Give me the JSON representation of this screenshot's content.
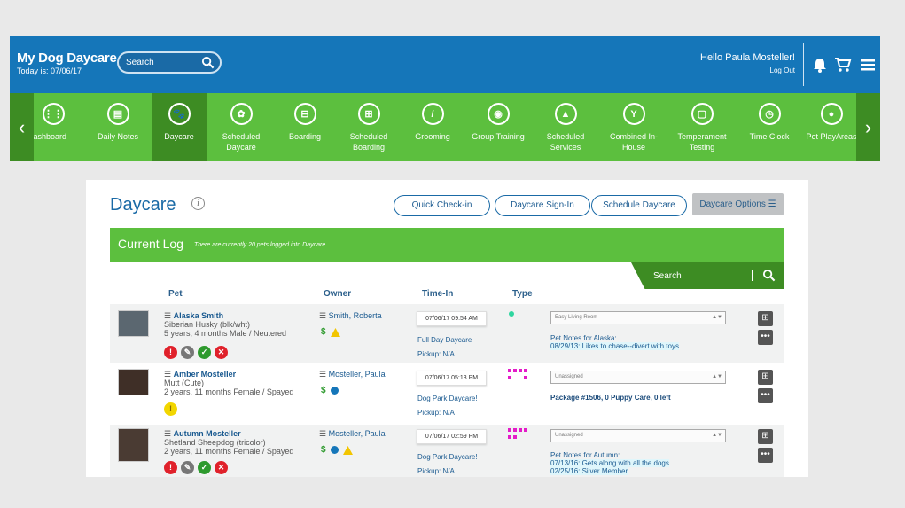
{
  "header": {
    "app_title": "My Dog Daycare",
    "today": "Today is: 07/06/17",
    "search_placeholder": "Search",
    "greeting": "Hello Paula Mosteller!",
    "logout": "Log Out"
  },
  "nav": {
    "prev": "‹",
    "next": "›",
    "items": [
      {
        "label": "Dashboard",
        "label2": "",
        "icon": "⋮⋮"
      },
      {
        "label": "Daily Notes",
        "label2": "",
        "icon": "▤"
      },
      {
        "label": "Daycare",
        "label2": "",
        "icon": "🐾"
      },
      {
        "label": "Scheduled",
        "label2": "Daycare",
        "icon": "✿"
      },
      {
        "label": "Boarding",
        "label2": "",
        "icon": "⊟"
      },
      {
        "label": "Scheduled",
        "label2": "Boarding",
        "icon": "⊞"
      },
      {
        "label": "Grooming",
        "label2": "",
        "icon": "/"
      },
      {
        "label": "Group Training",
        "label2": "",
        "icon": "◉"
      },
      {
        "label": "Scheduled",
        "label2": "Services",
        "icon": "▲"
      },
      {
        "label": "Combined In-",
        "label2": "House",
        "icon": "Y"
      },
      {
        "label": "Temperament",
        "label2": "Testing",
        "icon": "▢"
      },
      {
        "label": "Time Clock",
        "label2": "",
        "icon": "◷"
      },
      {
        "label": "Pet PlayAreas",
        "label2": "",
        "icon": "●"
      }
    ]
  },
  "page": {
    "title": "Daycare",
    "info": "i",
    "btn_quick": "Quick Check-in",
    "btn_signin": "Daycare Sign-In",
    "btn_schedule": "Schedule Daycare",
    "btn_options": "Daycare Options ☰",
    "log_title": "Current Log",
    "log_sub": "There are currently 20 pets logged into Daycare.",
    "table_search": "Search",
    "cols": {
      "pet": "Pet",
      "owner": "Owner",
      "timein": "Time-In",
      "type": "Type"
    }
  },
  "rows": [
    {
      "pet": "Alaska Smith",
      "breed": "Siberian Husky (blk/wht)",
      "age": "5 years, 4 months Male / Neutered",
      "owner": "Smith, Roberta",
      "time": "07/06/17 09:54 AM",
      "svc1": "Full Day Daycare",
      "svc2": "Pickup: N/A",
      "select": "Easy Living Room",
      "note1": "Pet Notes for Alaska:",
      "note2": "08/29/13: Likes to chase--divert with toys",
      "note3": ""
    },
    {
      "pet": "Amber Mosteller",
      "breed": "Mutt (Cute)",
      "age": "2 years, 11 months Female / Spayed",
      "owner": "Mosteller, Paula",
      "time": "07/06/17 05:13 PM",
      "svc1": "Dog Park Daycare!",
      "svc2": "Pickup: N/A",
      "select": "Unassigned",
      "note1": "Package #1506, 0 Puppy Care, 0 left",
      "note2": "",
      "note3": ""
    },
    {
      "pet": "Autumn Mosteller",
      "breed": "Shetland Sheepdog (tricolor)",
      "age": "2 years, 11 months Female / Spayed",
      "owner": "Mosteller, Paula",
      "time": "07/06/17 02:59 PM",
      "svc1": "Dog Park Daycare!",
      "svc2": "Pickup: N/A",
      "select": "Unassigned",
      "note1": "Pet Notes for Autumn:",
      "note2": "07/13/16: Gets along with all the dogs",
      "note3": "02/25/16: Silver Member"
    }
  ],
  "colors": {
    "blue": "#1576b9",
    "green": "#5cbf3e",
    "dark_green": "#3d8c23",
    "magenta": "#e41bc8",
    "teal_dot": "#2fd6a0"
  }
}
